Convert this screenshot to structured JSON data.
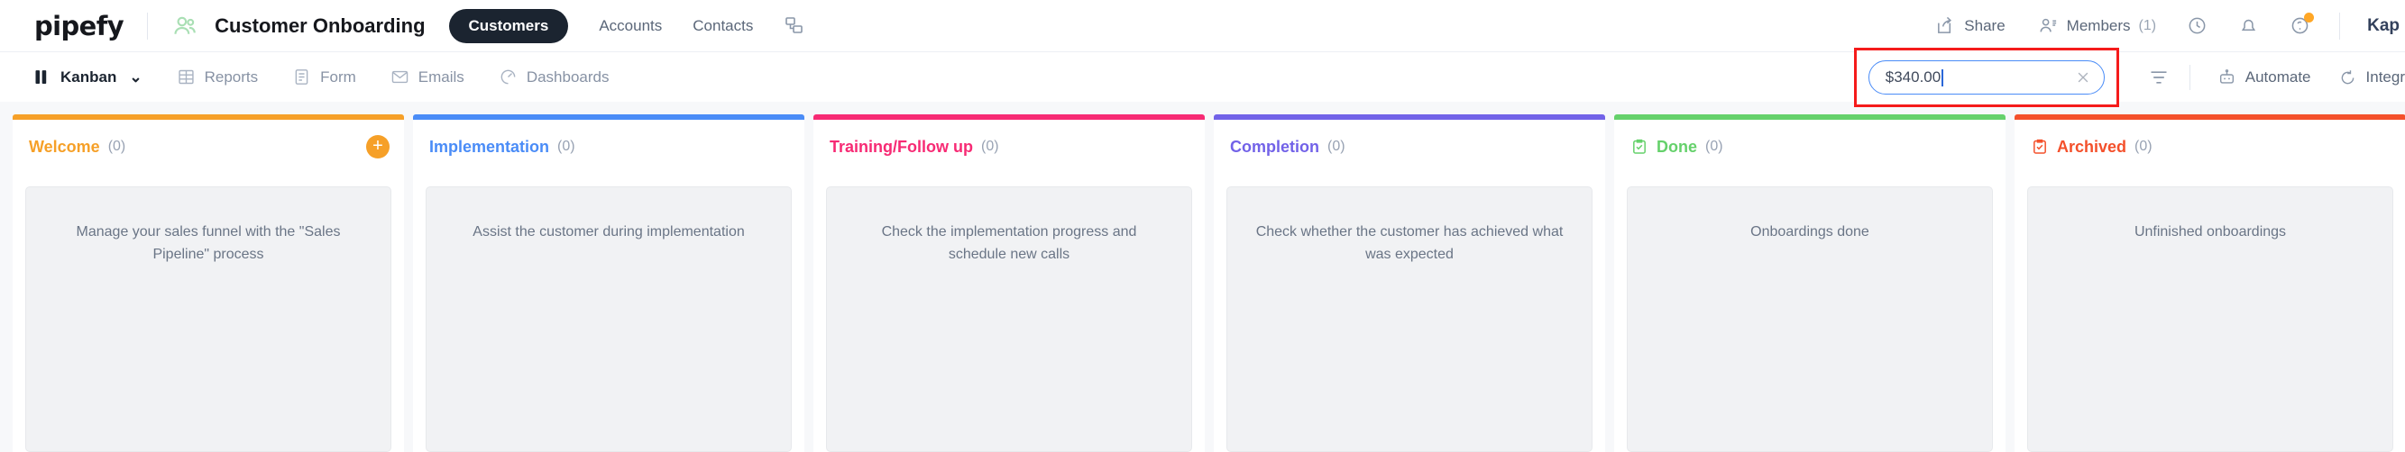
{
  "header": {
    "logo": "pipefy",
    "people_icon": "people-icon",
    "project_title": "Customer Onboarding",
    "active_pill": "Customers",
    "nav": [
      {
        "label": "Accounts"
      },
      {
        "label": "Contacts"
      }
    ],
    "relation_icon": "relations-icon",
    "right": {
      "share": {
        "label": "Share",
        "icon": "share-icon"
      },
      "members": {
        "label": "Members",
        "count": "(1)",
        "icon": "members-icon"
      },
      "history_icon": "clock-history-icon",
      "notifications_icon": "bell-icon",
      "help_icon": "help-circle-icon",
      "user_name": "Kap"
    }
  },
  "toolbar": {
    "views": [
      {
        "label": "Kanban",
        "icon": "kanban-icon",
        "active": true,
        "chevron": "⌄"
      },
      {
        "label": "Reports",
        "icon": "table-icon",
        "active": false
      },
      {
        "label": "Form",
        "icon": "form-icon",
        "active": false
      },
      {
        "label": "Emails",
        "icon": "envelope-icon",
        "active": false
      },
      {
        "label": "Dashboards",
        "icon": "dashboard-icon",
        "active": false
      }
    ],
    "search": {
      "value": "$340.00",
      "clear_icon": "close-x-icon",
      "highlight_color": "#f51b1b",
      "focus_border_color": "#4a8cf7"
    },
    "filter_icon": "filter-icon",
    "automate": {
      "label": "Automate",
      "icon": "robot-icon"
    },
    "integrations": {
      "label": "Integr",
      "icon": "integrations-icon"
    }
  },
  "board": {
    "columns": [
      {
        "title": "Welcome",
        "count": "(0)",
        "color": "#f6a028",
        "card_text": "Manage your sales funnel with the \"Sales Pipeline\" process",
        "has_add": true,
        "add_label": "+",
        "has_check_icon": false
      },
      {
        "title": "Implementation",
        "count": "(0)",
        "color": "#4a8cf7",
        "card_text": "Assist the customer during implementation",
        "has_add": false,
        "has_check_icon": false
      },
      {
        "title": "Training/Follow up",
        "count": "(0)",
        "color": "#f72a74",
        "card_text": "Check the implementation progress and schedule new calls",
        "has_add": false,
        "has_check_icon": false
      },
      {
        "title": "Completion",
        "count": "(0)",
        "color": "#7262e8",
        "card_text": "Check whether the customer has achieved what was expected",
        "has_add": false,
        "has_check_icon": false
      },
      {
        "title": "Done",
        "count": "(0)",
        "color": "#65d16b",
        "card_text": "Onboardings done",
        "has_add": false,
        "has_check_icon": true
      },
      {
        "title": "Archived",
        "count": "(0)",
        "color": "#f4502b",
        "card_text": "Unfinished onboardings",
        "has_add": false,
        "has_check_icon": true
      }
    ],
    "scroll_arrow": "–"
  }
}
